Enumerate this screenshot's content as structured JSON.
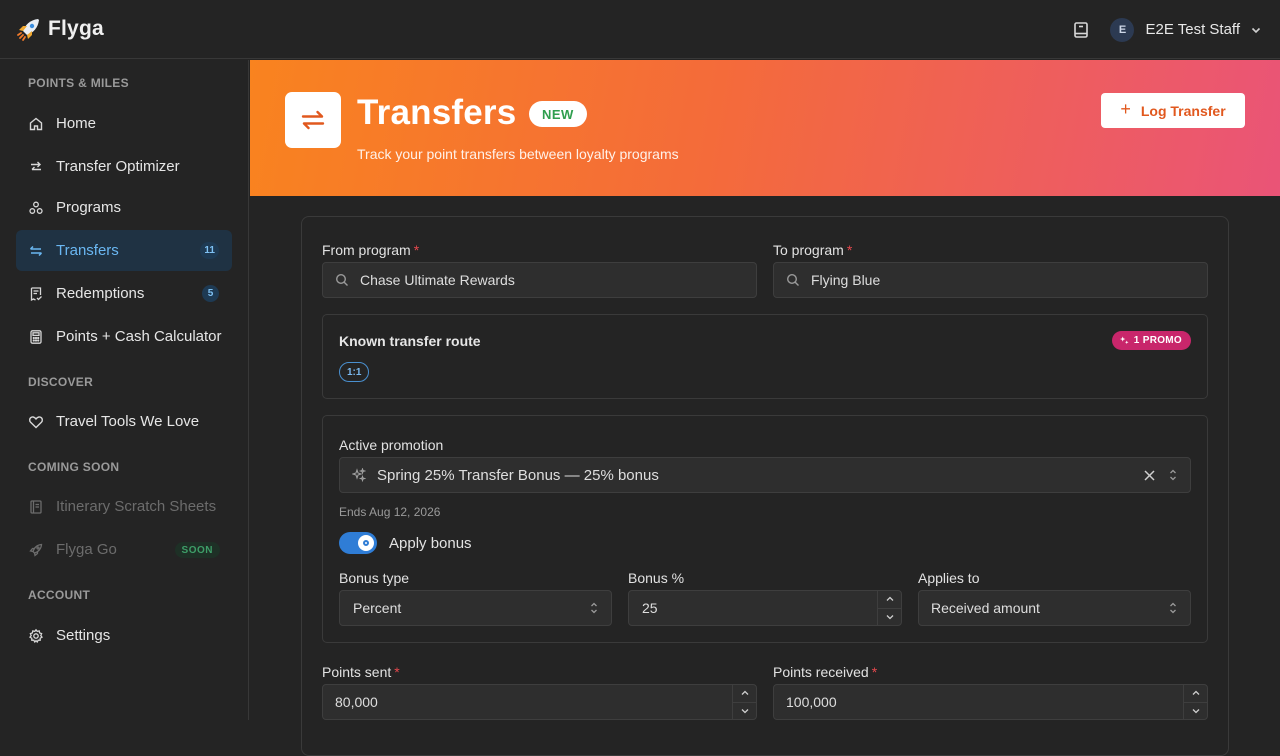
{
  "app": {
    "name": "Flyga"
  },
  "user": {
    "initial": "E",
    "name": "E2E Test Staff"
  },
  "sidebar": {
    "sections": [
      {
        "title": "POINTS & MILES"
      },
      {
        "title": "DISCOVER"
      },
      {
        "title": "COMING SOON"
      },
      {
        "title": "ACCOUNT"
      }
    ],
    "items": [
      {
        "label": "Home",
        "icon": "home-icon"
      },
      {
        "label": "Transfer Optimizer",
        "icon": "arrows-icon"
      },
      {
        "label": "Programs",
        "icon": "programs-icon"
      },
      {
        "label": "Transfers",
        "icon": "transfer-icon",
        "badge": "11",
        "active": true
      },
      {
        "label": "Redemptions",
        "icon": "receipt-icon",
        "badge": "5"
      },
      {
        "label": "Points + Cash Calculator",
        "icon": "calculator-icon"
      },
      {
        "label": "Travel Tools We Love",
        "icon": "heart-icon"
      },
      {
        "label": "Itinerary Scratch Sheets",
        "icon": "notebook-icon",
        "disabled": true
      },
      {
        "label": "Flyga Go",
        "icon": "rocket-icon",
        "badge": "SOON",
        "disabled": true
      },
      {
        "label": "Settings",
        "icon": "gear-icon"
      }
    ]
  },
  "hero": {
    "title": "Transfers",
    "badge": "NEW",
    "subtitle": "Track your point transfers between loyalty programs",
    "action_label": "Log Transfer"
  },
  "form": {
    "from_label": "From program",
    "from_value": "Chase Ultimate Rewards",
    "to_label": "To program",
    "to_value": "Flying Blue",
    "route": {
      "title": "Known transfer route",
      "ratio": "1:1",
      "promo_badge": "1 PROMO"
    },
    "promotion": {
      "label": "Active promotion",
      "value": "Spring 25% Transfer Bonus — 25% bonus",
      "ends": "Ends Aug 12, 2026",
      "apply_label": "Apply bonus",
      "apply_on": true,
      "bonus_type_label": "Bonus type",
      "bonus_type_value": "Percent",
      "bonus_pct_label": "Bonus %",
      "bonus_pct_value": "25",
      "applies_to_label": "Applies to",
      "applies_to_value": "Received amount"
    },
    "points_sent_label": "Points sent",
    "points_sent_value": "80,000",
    "points_received_label": "Points received",
    "points_received_value": "100,000"
  },
  "colors": {
    "accent": "#2f7dd6",
    "hero_start": "#f9831f",
    "hero_end": "#ea5477",
    "promo": "#c8266b"
  }
}
